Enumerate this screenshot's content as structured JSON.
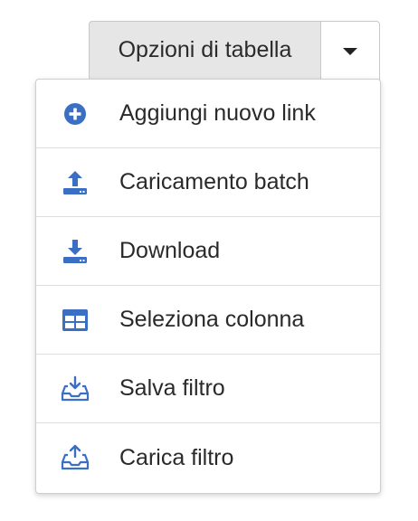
{
  "toolbar": {
    "options_label": "Opzioni di tabella"
  },
  "colors": {
    "icon_blue": "#3a6fc4",
    "button_bg": "#e6e6e6"
  },
  "menu": {
    "items": [
      {
        "label": "Aggiungi nuovo link",
        "icon": "plus-circle-icon"
      },
      {
        "label": "Caricamento batch",
        "icon": "upload-tray-icon"
      },
      {
        "label": "Download",
        "icon": "download-tray-icon"
      },
      {
        "label": "Seleziona colonna",
        "icon": "table-columns-icon"
      },
      {
        "label": "Salva filtro",
        "icon": "inbox-download-icon"
      },
      {
        "label": "Carica filtro",
        "icon": "inbox-upload-icon"
      }
    ]
  }
}
